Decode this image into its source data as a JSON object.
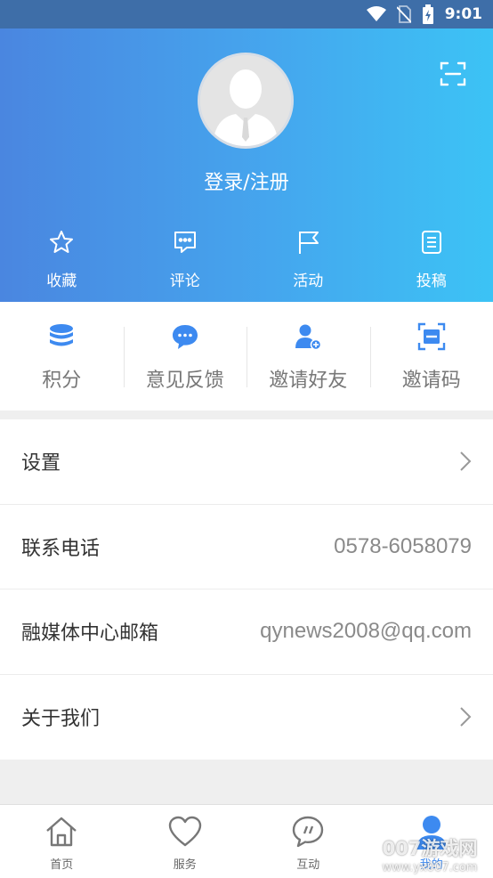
{
  "status_bar": {
    "time": "9:01"
  },
  "profile": {
    "login_label": "登录/注册"
  },
  "quick_actions": [
    {
      "label": "收藏",
      "icon": "star-icon"
    },
    {
      "label": "评论",
      "icon": "comment-icon"
    },
    {
      "label": "活动",
      "icon": "flag-icon"
    },
    {
      "label": "投稿",
      "icon": "document-icon"
    }
  ],
  "features": [
    {
      "label": "积分",
      "icon": "coins-icon"
    },
    {
      "label": "意见反馈",
      "icon": "chat-bubble-icon"
    },
    {
      "label": "邀请好友",
      "icon": "add-user-icon"
    },
    {
      "label": "邀请码",
      "icon": "scan-code-icon"
    }
  ],
  "menu": {
    "settings_label": "设置",
    "phone_label": "联系电话",
    "phone_value": "0578-6058079",
    "email_label": "融媒体中心邮箱",
    "email_value": "qynews2008@qq.com",
    "about_label": "关于我们"
  },
  "tabs": [
    {
      "label": "首页",
      "icon": "home-icon"
    },
    {
      "label": "服务",
      "icon": "heart-icon"
    },
    {
      "label": "互动",
      "icon": "chat-icon"
    },
    {
      "label": "我的",
      "icon": "person-icon",
      "active": true
    }
  ],
  "colors": {
    "accent": "#3d8af0",
    "header_start": "#4a86e0",
    "header_end": "#3cc3f5"
  },
  "watermark": {
    "line1": "007游戏网",
    "line2": "www.yx007.com"
  }
}
